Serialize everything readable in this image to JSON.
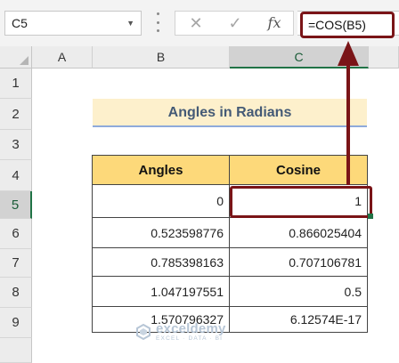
{
  "formula_bar": {
    "name_box": "C5",
    "cancel_icon": "close-icon",
    "enter_icon": "checkmark-icon",
    "function_label": "fx",
    "formula": "=COS(B5)"
  },
  "columns": [
    "A",
    "B",
    "C"
  ],
  "selected_column": "C",
  "rows": [
    "1",
    "2",
    "3",
    "4",
    "5",
    "6",
    "7",
    "8",
    "9"
  ],
  "selected_row": "5",
  "title": "Angles in Radians",
  "table": {
    "headers": [
      "Angles",
      "Cosine"
    ],
    "rows": [
      [
        "0",
        "1"
      ],
      [
        "0.523598776",
        "0.866025404"
      ],
      [
        "0.785398163",
        "0.707106781"
      ],
      [
        "1.047197551",
        "0.5"
      ],
      [
        "1.570796327",
        "6.12574E-17"
      ]
    ]
  },
  "watermark": {
    "name": "exceldemy",
    "tagline": "EXCEL · DATA · BI"
  },
  "colors": {
    "highlight": "#7a1417",
    "header_fill": "#fdd97a",
    "title_fill": "#fdf0cc",
    "excel_green": "#217346"
  }
}
